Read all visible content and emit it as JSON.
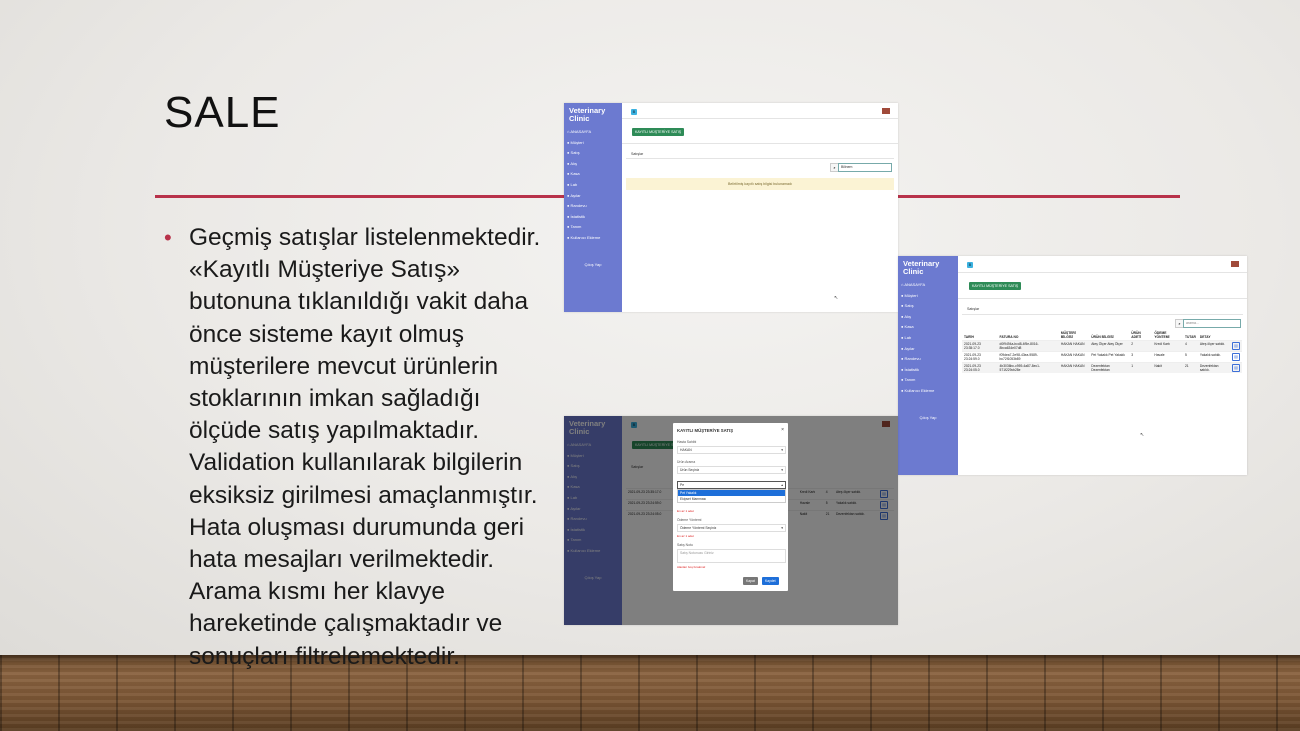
{
  "slide": {
    "title": "SALE",
    "bullet": "Geçmiş satışlar listelenmektedir. «Kayıtlı Müşteriye Satış» butonuna tıklanıldığı vakit daha önce sisteme kayıt olmuş müşterilere mevcut ürünlerin stoklarının imkan sağladığı ölçüde satış yapılmaktadır. Validation kullanılarak bilgilerin eksiksiz girilmesi amaçlanmıştır. Hata oluşması durumunda geri hata mesajları verilmektedir. Arama kısmı her klavye hareketinde çalışmaktadır ve sonuçları filtrelemektedir.",
    "accent_color": "#b8324a"
  },
  "app": {
    "brand": "Veterinary Clinic",
    "badge": "B",
    "sidebar_items": [
      "ANASAYFA",
      "Müşteri",
      "Satış",
      "Alış",
      "Kasa",
      "Lab",
      "Aşılar",
      "Randevu",
      "İstatistik",
      "Tanım",
      "Kullanıcı Ekleme"
    ],
    "logout": "Çıkış Yap",
    "sale_button": "KAYITLI MÜŞTERİYE SATIŞ",
    "section_label": "Satışlar"
  },
  "shot1": {
    "search_value": "Bilinem",
    "empty_message": "Belirtilmiş kayıtlı satış bilgisi bulunamadı"
  },
  "shot2": {
    "search_placeholder": "arama...",
    "columns": [
      "TARİH",
      "FATURA NO",
      "MÜŞTERİ BİLGİSİ",
      "ÜRÜN BİLGİSİ",
      "ÜRÜN ADETİ",
      "ÖDEME YÖNTEMİ",
      "TUTAR",
      "DETAY"
    ],
    "rows": [
      [
        "2021-09-23 23:35:17.0",
        "d0f9494a-bcd8-4f5e-8016-8bca634e07d8",
        "HAKAN HAKAN",
        "Ateş Ölçer Ateş Ölçer",
        "2",
        "Kredi Kartı",
        "4",
        "Ateş ölçer satıldı."
      ],
      [
        "2021-09-23 23:24:59.0",
        "f09dea7-2e98-43ea-9589-bc72f1053b89",
        "HAKAN HAKAN",
        "Pet Yakalık Pet Yakalık",
        "3",
        "Havale",
        "5",
        "Yakalık satıldı."
      ],
      [
        "2021-09-23 23:24:05.0",
        "4b3036bc-c959-4a87-8ec1-571f229cb28e",
        "HAKAN HAKAN",
        "Dezenfektan Dezenfektan",
        "1",
        "Nakit",
        "21",
        "Dezenfektan satıldı."
      ]
    ]
  },
  "shot3": {
    "modal_title": "KAYITLI MÜŞTERİYE SATIŞ",
    "owner_label": "Hasta Sahibi",
    "owner_value": "HAKAN",
    "product_search_label": "Ürün Arama",
    "product_placeholder": "Ürün Seçiniz",
    "typed_value": "Pe",
    "options": [
      "Pet Yakalık",
      "Ekipset Mamması"
    ],
    "product_error": "En az 1 adet",
    "payment_label": "Ödeme Yöntemi",
    "payment_placeholder": "Ödeme Yöntemi Seçiniz",
    "payment_error": "En az 1 adet",
    "note_label": "Satış Notu",
    "note_placeholder": "Satış Notunuzu Giriniz",
    "note_error": "Alanları boş bırakma!",
    "close_label": "Kapat",
    "save_label": "Kaydet",
    "bg_rows": [
      [
        "2021-09-23 23:35:17.0",
        "Kredi Kartı",
        "4",
        "Ateş ölçer satıldı."
      ],
      [
        "2021-09-23 23:24:59.0",
        "Havale",
        "5",
        "Yakalık satıldı."
      ],
      [
        "2021-09-23 23:24:05.0",
        "Nakit",
        "21",
        "Dezenfektan satıldı."
      ]
    ]
  }
}
